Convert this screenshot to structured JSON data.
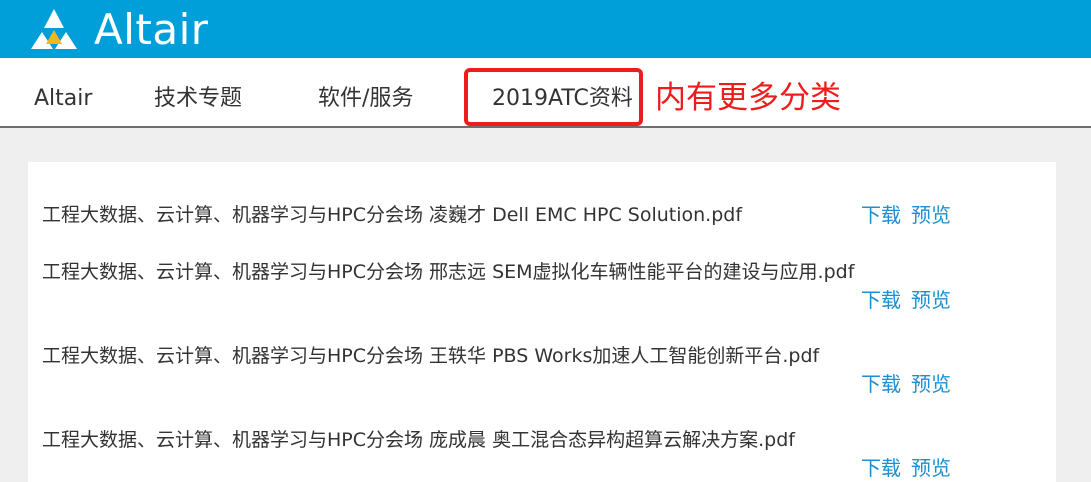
{
  "header": {
    "brand": "Altair",
    "colors": {
      "bar": "#009fda",
      "text": "#ffffff"
    }
  },
  "nav": {
    "items": [
      {
        "label": "Altair"
      },
      {
        "label": "技术专题"
      },
      {
        "label": "软件/服务"
      },
      {
        "label": "2019ATC资料"
      }
    ],
    "annotation": "内有更多分类",
    "highlight_color": "#ee1c1c"
  },
  "documents": [
    {
      "title": "工程大数据、云计算、机器学习与HPC分会场 凌巍才 Dell EMC HPC Solution.pdf",
      "download": "下载",
      "preview": "预览"
    },
    {
      "title": "工程大数据、云计算、机器学习与HPC分会场 邢志远 SEM虚拟化车辆性能平台的建设与应用.pdf",
      "download": "下载",
      "preview": "预览"
    },
    {
      "title": "工程大数据、云计算、机器学习与HPC分会场 王轶华 PBS Works加速人工智能创新平台.pdf",
      "download": "下载",
      "preview": "预览"
    },
    {
      "title": "工程大数据、云计算、机器学习与HPC分会场 庞成晨 奥工混合态异构超算云解决方案.pdf",
      "download": "下载",
      "preview": "预览"
    }
  ],
  "link_color": "#1f8fd1"
}
